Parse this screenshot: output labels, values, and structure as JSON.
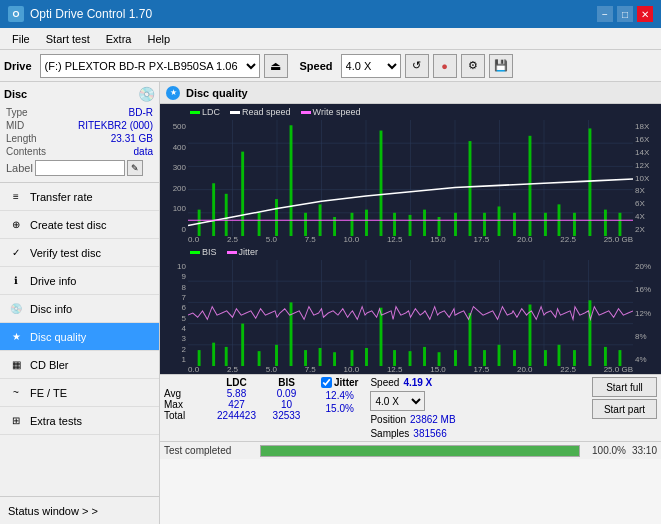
{
  "titlebar": {
    "title": "Opti Drive Control 1.70",
    "icon": "O",
    "minimize": "−",
    "maximize": "□",
    "close": "✕"
  },
  "menu": {
    "items": [
      "File",
      "Start test",
      "Extra",
      "Help"
    ]
  },
  "toolbar": {
    "drive_label": "Drive",
    "drive_value": "(F:) PLEXTOR BD-R  PX-LB950SA 1.06",
    "speed_label": "Speed",
    "speed_value": "4.0 X",
    "eject_symbol": "⏏"
  },
  "disc": {
    "type_label": "Type",
    "type_value": "BD-R",
    "mid_label": "MID",
    "mid_value": "RITEKBR2 (000)",
    "length_label": "Length",
    "length_value": "23.31 GB",
    "contents_label": "Contents",
    "contents_value": "data",
    "label_label": "Label",
    "label_value": ""
  },
  "nav": {
    "items": [
      {
        "id": "transfer-rate",
        "label": "Transfer rate",
        "icon": "≡"
      },
      {
        "id": "create-test-disc",
        "label": "Create test disc",
        "icon": "⊕"
      },
      {
        "id": "verify-test-disc",
        "label": "Verify test disc",
        "icon": "✓"
      },
      {
        "id": "drive-info",
        "label": "Drive info",
        "icon": "ℹ"
      },
      {
        "id": "disc-info",
        "label": "Disc info",
        "icon": "💿"
      },
      {
        "id": "disc-quality",
        "label": "Disc quality",
        "icon": "★",
        "active": true
      },
      {
        "id": "cd-bler",
        "label": "CD Bler",
        "icon": "▦"
      },
      {
        "id": "fe-te",
        "label": "FE / TE",
        "icon": "~"
      },
      {
        "id": "extra-tests",
        "label": "Extra tests",
        "icon": "⊞"
      }
    ],
    "status_window": "Status window > >"
  },
  "chart": {
    "title": "Disc quality",
    "top_legend": [
      "LDC",
      "Read speed",
      "Write speed"
    ],
    "top_legend_colors": [
      "#00ff00",
      "#ffffff",
      "#ff66ff"
    ],
    "bottom_legend": [
      "BIS",
      "Jitter"
    ],
    "bottom_legend_colors": [
      "#00ff00",
      "#ff66ff"
    ],
    "top_y_left": [
      "500",
      "400",
      "300",
      "200",
      "100",
      "0"
    ],
    "top_y_right": [
      "18X",
      "16X",
      "14X",
      "12X",
      "10X",
      "8X",
      "6X",
      "4X",
      "2X"
    ],
    "x_labels": [
      "0.0",
      "2.5",
      "5.0",
      "7.5",
      "10.0",
      "12.5",
      "15.0",
      "17.5",
      "20.0",
      "22.5",
      "25.0 GB"
    ],
    "bottom_y_left": [
      "10",
      "9",
      "8",
      "7",
      "6",
      "5",
      "4",
      "3",
      "2",
      "1"
    ],
    "bottom_y_right": [
      "20%",
      "16%",
      "12%",
      "8%",
      "4%"
    ]
  },
  "stats": {
    "col_ldc": "LDC",
    "col_bis": "BIS",
    "col_jitter": "Jitter",
    "row_avg": "Avg",
    "row_max": "Max",
    "row_total": "Total",
    "avg_ldc": "5.88",
    "avg_bis": "0.09",
    "avg_jitter": "12.4%",
    "max_ldc": "427",
    "max_bis": "10",
    "max_jitter": "15.0%",
    "total_ldc": "2244423",
    "total_bis": "32533",
    "speed_label": "Speed",
    "speed_value": "4.19 X",
    "speed_select": "4.0 X",
    "position_label": "Position",
    "position_value": "23862 MB",
    "samples_label": "Samples",
    "samples_value": "381566",
    "start_full": "Start full",
    "start_part": "Start part",
    "jitter_checked": true,
    "jitter_label": "Jitter"
  },
  "progress": {
    "status_text": "Test completed",
    "percent": "100.0%",
    "fill_width": "100%",
    "time": "33:10"
  }
}
